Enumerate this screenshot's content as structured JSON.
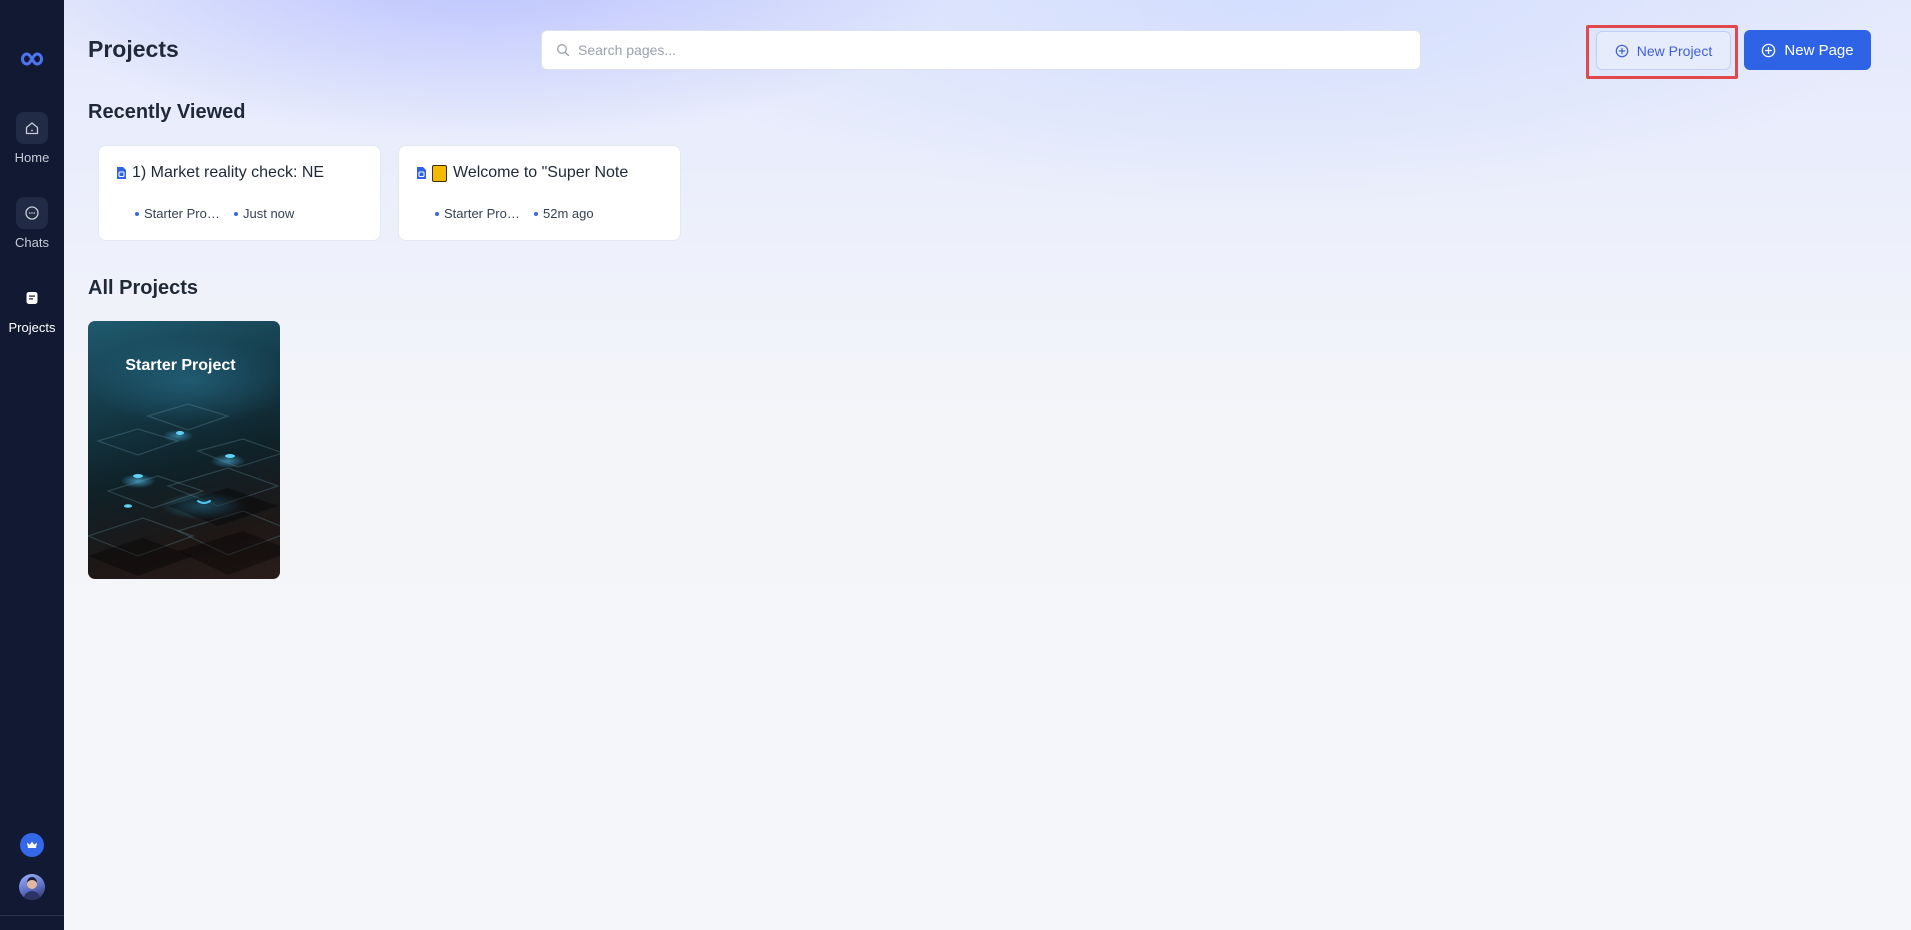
{
  "sidebar": {
    "logo": "infinity-logo",
    "items": [
      {
        "label": "Home",
        "icon": "home-icon"
      },
      {
        "label": "Chats",
        "icon": "chat-bubble-icon"
      },
      {
        "label": "Projects",
        "icon": "document-icon"
      }
    ],
    "active": "Projects",
    "bottom": [
      {
        "icon": "crown-icon"
      },
      {
        "icon": "avatar"
      }
    ]
  },
  "header": {
    "title": "Projects",
    "search": {
      "placeholder": "Search pages...",
      "value": ""
    },
    "new_project_label": "New Project",
    "new_page_label": "New Page"
  },
  "recently_viewed": {
    "title": "Recently Viewed",
    "items": [
      {
        "title": "1) Market reality check: NE",
        "project": "Starter Project",
        "time": "Just now",
        "has_emoji": false
      },
      {
        "title": "Welcome to \"Super Note",
        "project": "Starter Project",
        "time": "52m ago",
        "has_emoji": true
      }
    ]
  },
  "all_projects": {
    "title": "All Projects",
    "items": [
      {
        "name": "Starter Project",
        "cover": "keyboard-photo"
      }
    ]
  },
  "colors": {
    "sidebar_bg": "#121a33",
    "accent": "#2f63e6",
    "highlight": "#e0484a"
  }
}
